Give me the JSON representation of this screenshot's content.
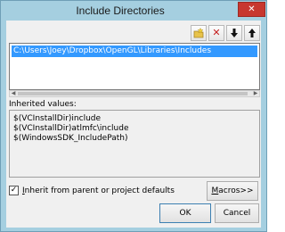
{
  "window": {
    "title": "Include Directories",
    "close_glyph": "✕"
  },
  "toolbar": {
    "new_line_icon": "new-line-icon",
    "delete_icon": "delete-icon",
    "delete_glyph": "✕",
    "move_down_icon": "arrow-down-icon",
    "move_up_icon": "arrow-up-icon"
  },
  "list": {
    "items": [
      {
        "value": "C:\\Users\\Joey\\Dropbox\\OpenGL\\Libraries\\Includes",
        "selected": true
      }
    ]
  },
  "inherited": {
    "label": "Inherited values:",
    "values": [
      "$(VCInstallDir)include",
      "$(VCInstallDir)atlmfc\\include",
      "$(WindowsSDK_IncludePath)"
    ]
  },
  "inherit_checkbox": {
    "checked": true,
    "check_glyph": "✓",
    "accel": "I",
    "label_rest": "nherit from parent or project defaults"
  },
  "buttons": {
    "macros_accel": "M",
    "macros_rest": "acros>>",
    "ok": "OK",
    "cancel": "Cancel"
  },
  "colors": {
    "window_frame": "#a5cfe0",
    "client_bg": "#f0f0f0",
    "selection": "#3399ff",
    "close_button": "#c7372f"
  }
}
